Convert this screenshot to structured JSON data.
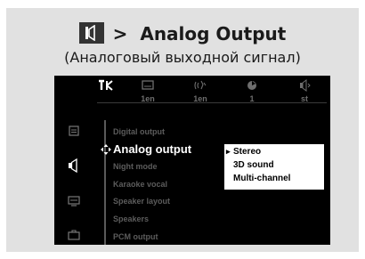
{
  "heading": {
    "icon": "speaker-icon",
    "separator": ">",
    "title": "Analog Output",
    "subtitle": "(Аналоговый выходной сигнал)"
  },
  "topbar": {
    "tools_icon": "tools-icon",
    "items": [
      {
        "icon": "subtitle-icon",
        "label": "1en"
      },
      {
        "icon": "audio-icon",
        "label": "1en"
      },
      {
        "icon": "angle-icon",
        "label": "1"
      },
      {
        "icon": "sound-mode-icon",
        "label": "st"
      }
    ]
  },
  "sidebar": {
    "items": [
      {
        "icon": "general-settings-icon",
        "selected": false
      },
      {
        "icon": "audio-settings-icon",
        "selected": true
      },
      {
        "icon": "video-settings-icon",
        "selected": false
      },
      {
        "icon": "preferences-icon",
        "selected": false
      }
    ]
  },
  "menu": {
    "items": [
      {
        "label": "Digital output",
        "active": false
      },
      {
        "label": "Analog output",
        "active": true
      },
      {
        "label": "Night mode",
        "active": false
      },
      {
        "label": "Karaoke vocal",
        "active": false
      },
      {
        "label": "Speaker layout",
        "active": false
      },
      {
        "label": "Speakers",
        "active": false
      },
      {
        "label": "PCM output",
        "active": false
      }
    ]
  },
  "submenu": {
    "options": [
      "Stereo",
      "3D sound",
      "Multi-channel"
    ],
    "selected": "Stereo"
  },
  "colors": {
    "panel": "#e1e1e1",
    "screen": "#000000",
    "inactive_text": "#5c5c5c",
    "active_text": "#ffffff",
    "submenu_bg": "#ffffff"
  }
}
